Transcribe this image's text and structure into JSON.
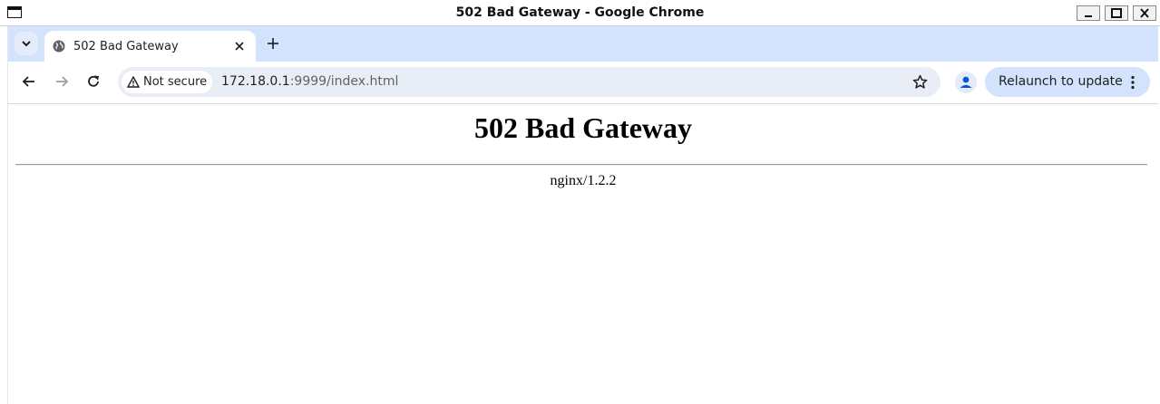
{
  "window": {
    "title": "502 Bad Gateway - Google Chrome"
  },
  "tabs": [
    {
      "title": "502 Bad Gateway",
      "favicon": "globe-icon",
      "active": true
    }
  ],
  "toolbar": {
    "security_label": "Not secure",
    "url_host": "172.18.0.1",
    "url_rest": ":9999/index.html",
    "relaunch_label": "Relaunch to update"
  },
  "page": {
    "heading": "502 Bad Gateway",
    "server": "nginx/1.2.2"
  },
  "colors": {
    "tabstrip": "#d3e3fd",
    "omnibox": "#e9eef6",
    "relaunch_button": "#d3e3fd"
  }
}
